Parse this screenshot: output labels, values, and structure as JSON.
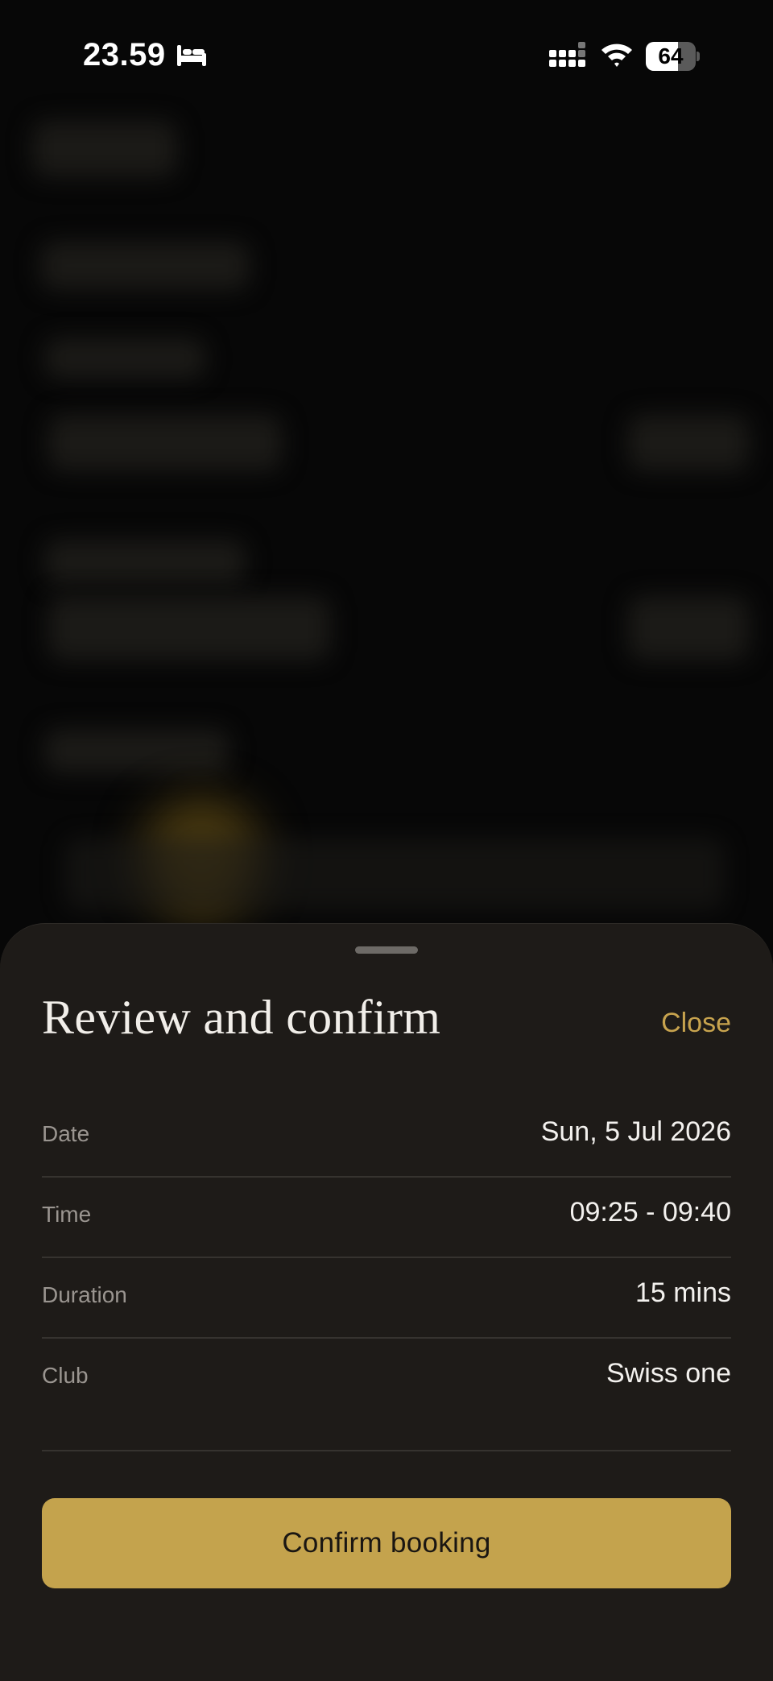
{
  "status_bar": {
    "time": "23.59",
    "battery_level": "64",
    "sleep_icon": "bed-icon",
    "signal_icon": "cellular-signal-icon",
    "wifi_icon": "wifi-icon"
  },
  "sheet": {
    "title": "Review and confirm",
    "close_label": "Close",
    "details": [
      {
        "label": "Date",
        "value": "Sun, 5 Jul 2026"
      },
      {
        "label": "Time",
        "value": "09:25 - 09:40"
      },
      {
        "label": "Duration",
        "value": "15 mins"
      },
      {
        "label": "Club",
        "value": "Swiss one"
      }
    ],
    "confirm_label": "Confirm booking"
  },
  "colors": {
    "accent": "#c4a34d",
    "sheet_background": "#1e1b18",
    "page_background": "#070707"
  }
}
